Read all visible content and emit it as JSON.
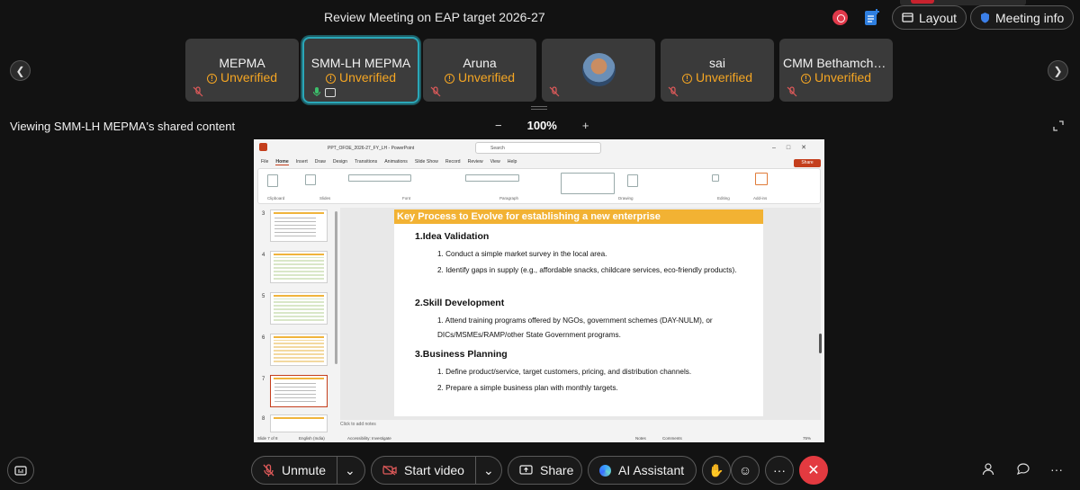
{
  "meeting": {
    "title": "Review Meeting on EAP target 2026-27",
    "layout_label": "Layout",
    "info_label": "Meeting info",
    "viewing_text": "Viewing SMM-LH MEPMA's shared content",
    "zoom_level": "100%",
    "zoom_minus": "−",
    "zoom_plus": "+"
  },
  "participants": [
    {
      "name": "MEPMA",
      "status": "Unverified"
    },
    {
      "name": "SMM-LH MEPMA",
      "status": "Unverified"
    },
    {
      "name": "Aruna",
      "status": "Unverified"
    },
    {
      "name": "",
      "status": ""
    },
    {
      "name": "sai",
      "status": "Unverified"
    },
    {
      "name": "CMM Bethamche...",
      "status": "Unverified"
    }
  ],
  "powerpoint": {
    "filename": "PPT_OFOE_2026-27_FY_LH  -  PowerPoint",
    "search_placeholder": "Search",
    "menu": [
      "File",
      "Home",
      "Insert",
      "Draw",
      "Design",
      "Transitions",
      "Animations",
      "Slide Show",
      "Record",
      "Review",
      "View",
      "Help"
    ],
    "share_label": "Share",
    "ribbon_groups": [
      "Clipboard",
      "Slides",
      "Font",
      "Paragraph",
      "Drawing",
      "Editing",
      "Add-ins"
    ],
    "thumb_numbers": [
      "3",
      "4",
      "5",
      "6",
      "7",
      "8"
    ],
    "notes_placeholder": "Click to add notes",
    "status_left": "Slide 7 of 8",
    "status_lang": "English (India)",
    "status_access": "Accessibility: Investigate",
    "status_notes": "Notes",
    "status_comments": "Comments",
    "status_zoom": "75%"
  },
  "slide": {
    "heading": "Key Process to Evolve for establishing a new enterprise",
    "sections": [
      {
        "title": "1.Idea Validation",
        "items": [
          "1. Conduct a simple market survey in the local area.",
          "2. Identify gaps in supply (e.g., affordable snacks, childcare services, eco-friendly products)."
        ]
      },
      {
        "title": "2.Skill Development",
        "items": [
          "1. Attend training programs offered by NGOs, government schemes (DAY-NULM), or DICs/MSMEs/RAMP/other State Government programs."
        ]
      },
      {
        "title": "3.Business Planning",
        "items": [
          "1. Define product/service, target customers, pricing, and distribution channels.",
          "2. Prepare a simple business plan with monthly targets."
        ]
      }
    ]
  },
  "controls": {
    "unmute": "Unmute",
    "start_video": "Start video",
    "share": "Share",
    "ai_assistant": "AI Assistant",
    "more": "···"
  },
  "colors": {
    "accent_teal": "#2aa7b8",
    "warning": "#f5a623",
    "hangup": "#e33a40",
    "slide_header": "#f2b233"
  }
}
